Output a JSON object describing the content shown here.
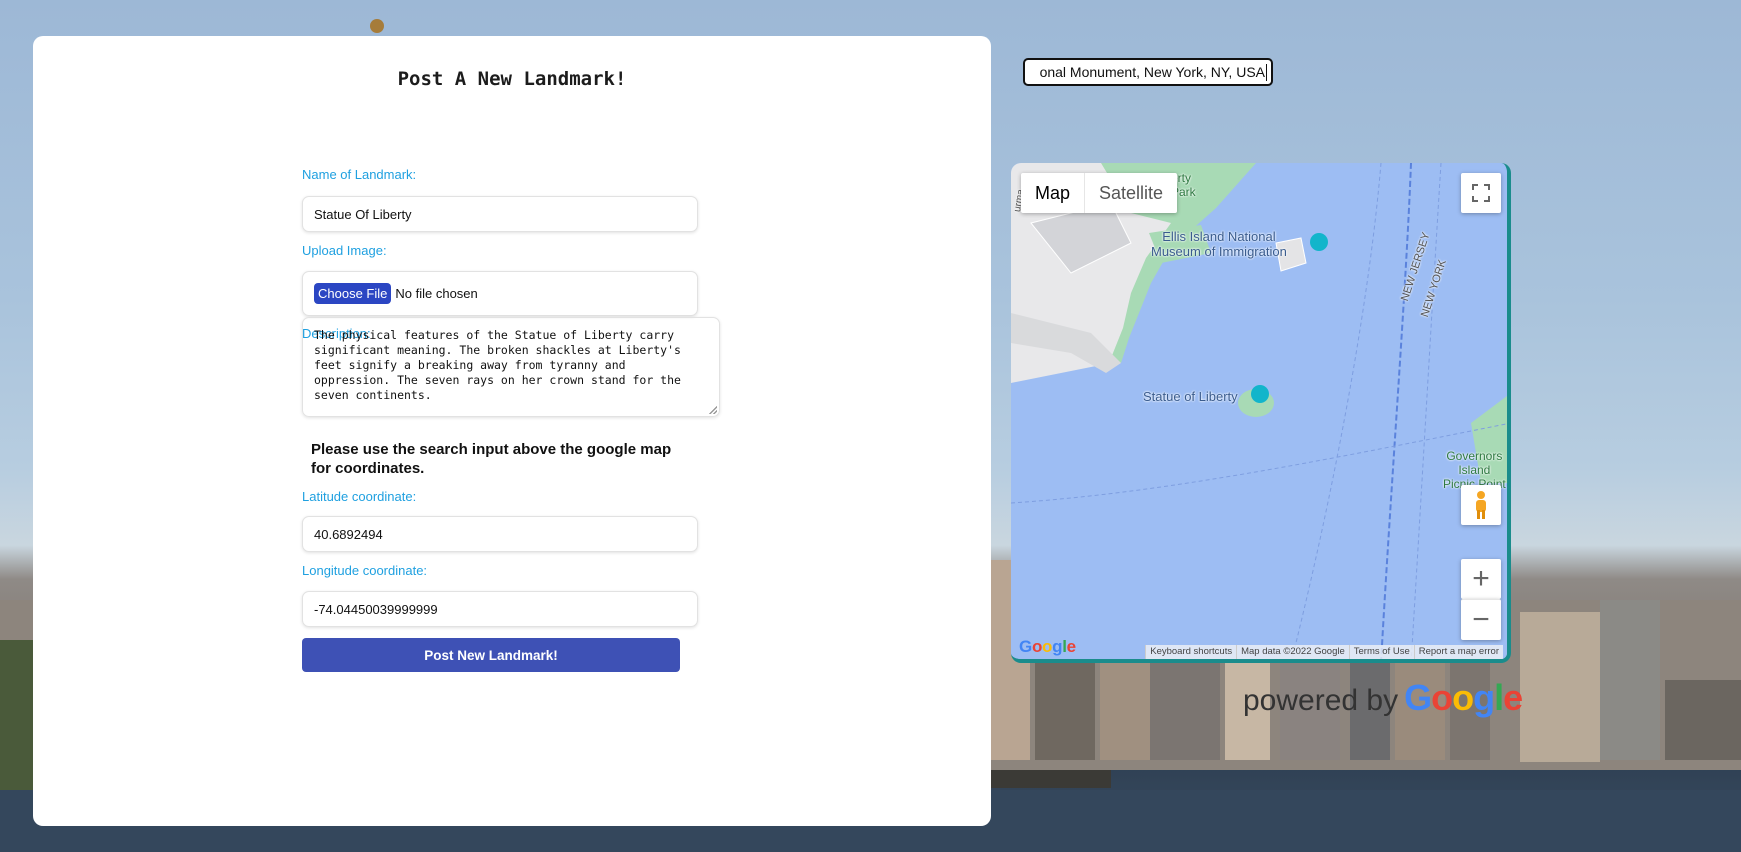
{
  "form": {
    "title": "Post A New Landmark!",
    "name_label": "Name of Landmark:",
    "name_value": "Statue Of Liberty",
    "upload_label": "Upload Image:",
    "file_button": "Choose File",
    "file_status": "No file chosen",
    "description_label": "Description:",
    "description_value": "The physical features of the Statue of Liberty carry significant meaning. The broken shackles at Liberty's feet signify a breaking away from tyranny and oppression. The seven rays on her crown stand for the seven continents.",
    "coordinate_note": "Please use the search input above the google map for coordinates.",
    "latitude_label": "Latitude coordinate:",
    "latitude_value": "40.6892494",
    "longitude_label": "Longitude coordinate:",
    "longitude_value": "-74.04450039999999",
    "submit_label": "Post New Landmark!"
  },
  "place_search": {
    "value": "onal Monument, New York, NY, USA"
  },
  "map": {
    "type_map": "Map",
    "type_satellite": "Satellite",
    "labels": {
      "liberty_park": "erty\nPark",
      "ellis_island": "Ellis Island National\nMuseum of Immigration",
      "statue": "Statue of Liberty",
      "new_jersey": "NEW JERSEY",
      "new_york": "NEW YORK",
      "governors": "Governors\nIsland\nPicnic Point",
      "burma": "urma"
    },
    "zoom_in": "+",
    "zoom_out": "−",
    "logo": "Google",
    "attribution": [
      "Keyboard shortcuts",
      "Map data ©2022 Google",
      "Terms of Use",
      "Report a map error"
    ],
    "colors": {
      "water": "#9dbdf3",
      "land": "#e8e8ea",
      "park": "#a8dab5",
      "accent_border": "#1a8c8c"
    }
  },
  "powered_by": {
    "prefix": "powered by",
    "brand": "Google"
  },
  "colors": {
    "label": "#1fa0e0",
    "primary_button": "#3e51b5",
    "file_button": "#2b46c3"
  }
}
